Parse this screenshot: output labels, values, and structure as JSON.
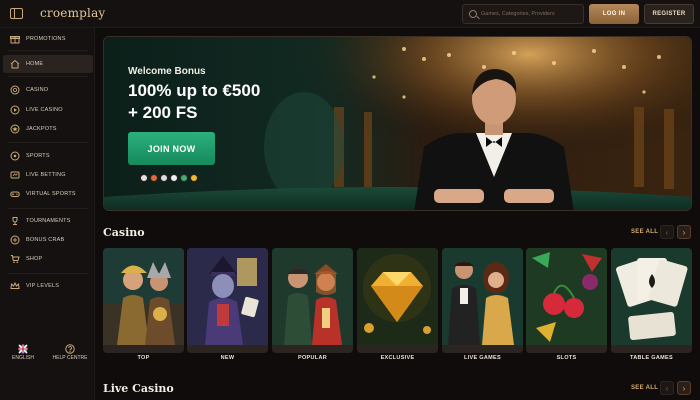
{
  "header": {
    "logo_text": "croemplay",
    "search_placeholder": "Games, Categories, Providers",
    "login_label": "LOG IN",
    "register_label": "REGISTER"
  },
  "sidebar": {
    "items": [
      {
        "label": "PROMOTIONS",
        "icon": "gift-icon"
      },
      {
        "label": "HOME",
        "icon": "home-icon",
        "active": true
      },
      {
        "label": "CASINO",
        "icon": "chip-icon"
      },
      {
        "label": "LIVE CASINO",
        "icon": "live-icon"
      },
      {
        "label": "JACKPOTS",
        "icon": "jackpot-icon"
      },
      {
        "label": "SPORTS",
        "icon": "ball-icon"
      },
      {
        "label": "LIVE BETTING",
        "icon": "live-betting-icon"
      },
      {
        "label": "VIRTUAL SPORTS",
        "icon": "controller-icon"
      },
      {
        "label": "TOURNAMENTS",
        "icon": "trophy-icon"
      },
      {
        "label": "BONUS CRAB",
        "icon": "bonus-icon"
      },
      {
        "label": "SHOP",
        "icon": "cart-icon"
      },
      {
        "label": "VIP LEVELS",
        "icon": "crown-icon"
      }
    ],
    "bottom": {
      "language_label": "ENGLISH",
      "help_label": "HELP CENTRE"
    }
  },
  "banner": {
    "subtitle": "Welcome Bonus",
    "title_line1": "100% up to €500",
    "title_line2": "+ 200 FS",
    "cta_label": "JOIN NOW"
  },
  "casino": {
    "title": "Casino",
    "see_all": "SEE ALL",
    "cards": [
      {
        "label": "TOP"
      },
      {
        "label": "NEW"
      },
      {
        "label": "POPULAR"
      },
      {
        "label": "EXCLUSIVE"
      },
      {
        "label": "LIVE GAMES"
      },
      {
        "label": "SLOTS"
      },
      {
        "label": "TABLE GAMES"
      }
    ]
  },
  "live_casino": {
    "title": "Live Casino",
    "see_all": "SEE ALL"
  },
  "colors": {
    "accent_gold": "#c9a977",
    "cta_green": "#1f9e6c",
    "background": "#0f0c0b"
  }
}
